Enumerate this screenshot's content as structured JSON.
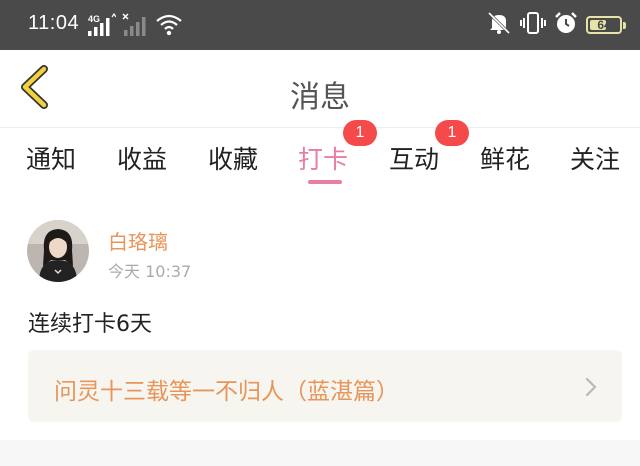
{
  "status_bar": {
    "time": "11:04",
    "network_label": "4G",
    "battery_level": 64,
    "battery_text": "64",
    "icons": [
      "signal-4g-icon",
      "signal-no-sim-icon",
      "wifi-icon",
      "mute-icon",
      "vibrate-icon",
      "alarm-icon",
      "battery-icon"
    ]
  },
  "header": {
    "title": "消息",
    "back_icon": "chevron-left-icon"
  },
  "tabs": [
    {
      "label": "通知",
      "active": false
    },
    {
      "label": "收益",
      "active": false
    },
    {
      "label": "收藏",
      "active": false
    },
    {
      "label": "打卡",
      "active": true,
      "badge": "1"
    },
    {
      "label": "互动",
      "active": false,
      "badge": "1"
    },
    {
      "label": "鲜花",
      "active": false
    },
    {
      "label": "关注",
      "active": false
    }
  ],
  "message": {
    "username": "白珞璃",
    "time": "今天 10:37",
    "text": "连续打卡6天",
    "link_title": "问灵十三载等一不归人（蓝湛篇）"
  },
  "colors": {
    "accent": "#e87da8",
    "badge": "#f54a4a",
    "username": "#e8955a",
    "back_icon": "#f2d23c"
  }
}
